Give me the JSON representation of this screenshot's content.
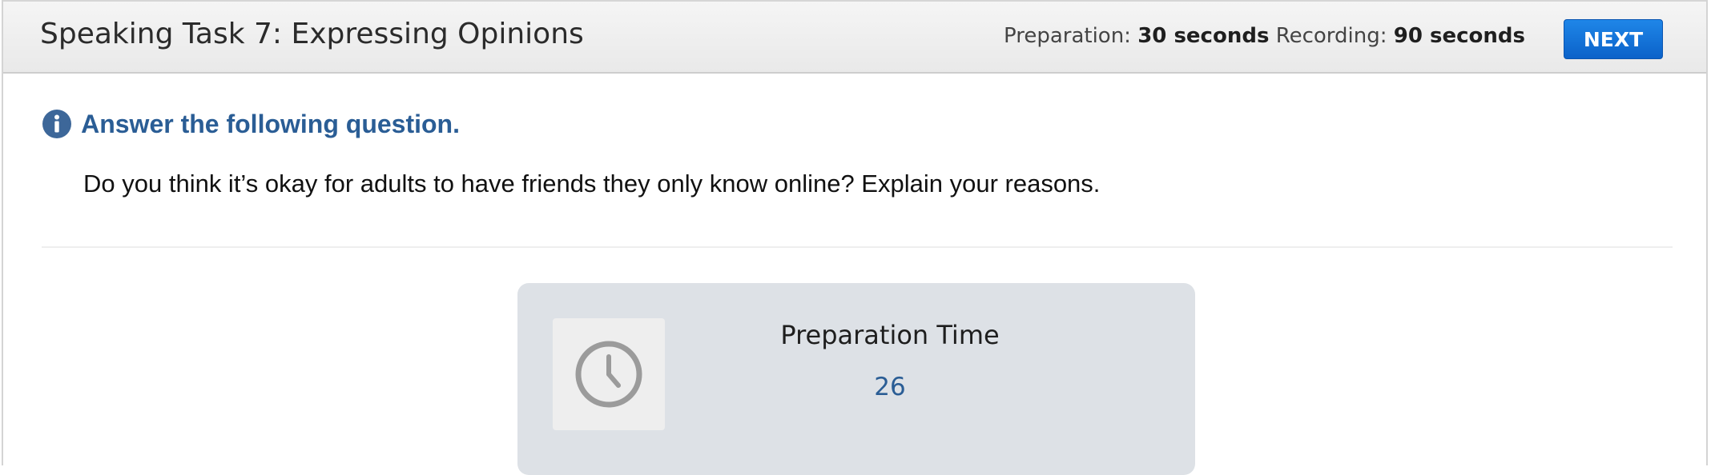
{
  "header": {
    "title": "Speaking Task 7: Expressing Opinions",
    "preparation_label": "Preparation:",
    "preparation_value": "30 seconds",
    "recording_label": "Recording:",
    "recording_value": "90 seconds",
    "next_label": "NEXT"
  },
  "instruction": {
    "icon": "info-icon",
    "text": "Answer the following question."
  },
  "question": "Do you think it’s okay for adults to have friends they only know online? Explain your reasons.",
  "preparation_panel": {
    "icon": "clock-icon",
    "label": "Preparation Time",
    "countdown": "26"
  },
  "colors": {
    "accent_blue": "#0b62c9",
    "instruction_blue": "#2a5d95",
    "panel_bg": "#dde1e6"
  }
}
